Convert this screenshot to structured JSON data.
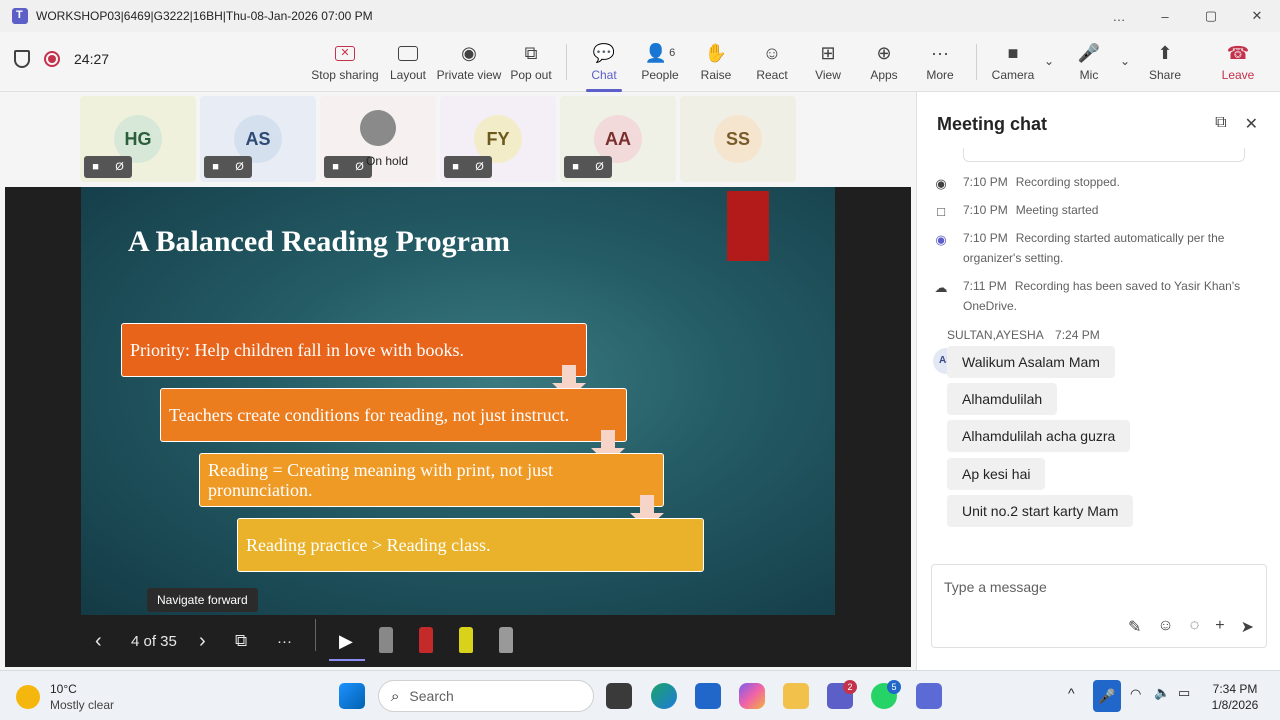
{
  "window": {
    "title": "WORKSHOP03|6469|G3222|16BH|Thu-08-Jan-2026 07:00 PM",
    "controls": [
      "…",
      "–",
      "▢",
      "✕"
    ]
  },
  "toolbar": {
    "timer": "24:27",
    "buttons": {
      "stop_sharing": "Stop sharing",
      "layout": "Layout",
      "private_view": "Private view",
      "pop_out": "Pop out",
      "chat": "Chat",
      "people": "People",
      "people_count": "6",
      "raise": "Raise",
      "react": "React",
      "view": "View",
      "apps": "Apps",
      "more": "More",
      "camera": "Camera",
      "mic": "Mic",
      "share": "Share",
      "leave": "Leave"
    }
  },
  "participants": [
    {
      "initials": "HG",
      "bg": "#f0f1dc",
      "avatar_bg": "#d7e8d9",
      "color": "#2b5e3b"
    },
    {
      "initials": "AS",
      "bg": "#e8edf5",
      "avatar_bg": "#d5e0ef",
      "color": "#2d4a75"
    },
    {
      "initials": "",
      "bg": "#f7f0f1",
      "avatar_bg": "#8a8a8a",
      "color": "#ffffff",
      "status_text": "On hold"
    },
    {
      "initials": "FY",
      "bg": "#f4eef6",
      "avatar_bg": "#f3ecc9",
      "color": "#6b5a1b"
    },
    {
      "initials": "AA",
      "bg": "#eff0e6",
      "avatar_bg": "#f2dada",
      "color": "#7a2e2e"
    },
    {
      "initials": "SS",
      "bg": "#efefe6",
      "avatar_bg": "#f5e5cf",
      "color": "#7a5a2a"
    }
  ],
  "slide": {
    "title": "A Balanced Reading Program",
    "steps": [
      {
        "text": "Priority: Help children fall in love with books.",
        "color": "#e8641b"
      },
      {
        "text": "Teachers create conditions for reading, not just instruct.",
        "color": "#ec7d1f"
      },
      {
        "text": "Reading = Creating meaning with print, not just pronunciation.",
        "color": "#f09a26"
      },
      {
        "text": "Reading practice > Reading class.",
        "color": "#e9b22a"
      }
    ],
    "tooltip": "Navigate forward",
    "counter": "4 of 35"
  },
  "chat": {
    "title": "Meeting chat",
    "events": [
      {
        "time": "7:10 PM",
        "text": "Recording stopped.",
        "icon": "◉"
      },
      {
        "time": "7:10 PM",
        "text": "Meeting started",
        "icon": "□"
      },
      {
        "time": "7:10 PM",
        "text": "Recording started automatically per the organizer's setting.",
        "icon": "◉"
      },
      {
        "time": "7:11 PM",
        "text": "Recording has been saved to Yasir Khan's OneDrive.",
        "icon": "☁"
      }
    ],
    "sender": "SULTAN,AYESHA",
    "sender_time": "7:24 PM",
    "sender_initials": "AS",
    "messages": [
      "Walikum Asalam Mam",
      "Alhamdulilah",
      "Alhamdulilah acha guzra",
      "Ap kesi hai",
      "Unit no.2 start karty Mam"
    ],
    "compose_placeholder": "Type a message"
  },
  "taskbar": {
    "weather_temp": "10°C",
    "weather_cond": "Mostly clear",
    "search": "Search",
    "teams_badge": "2",
    "whatsapp_badge": "5",
    "time": "7:34 PM",
    "date": "1/8/2026"
  }
}
